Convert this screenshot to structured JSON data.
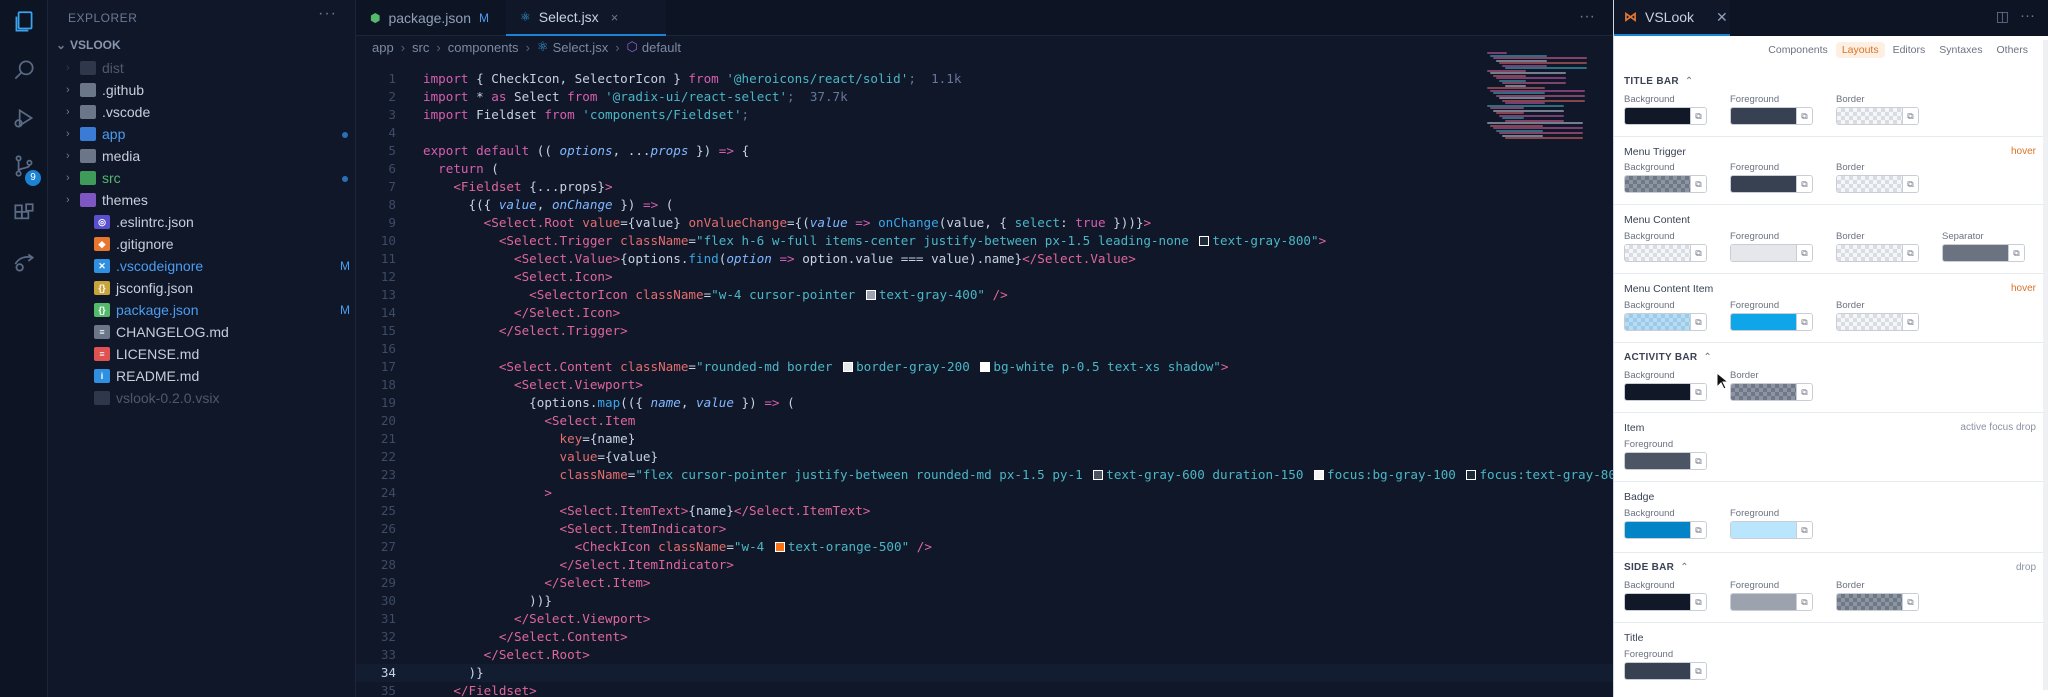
{
  "activity": {
    "scm_badge": "9"
  },
  "sidebar": {
    "title": "EXPLORER",
    "root": "VSLOOK",
    "items": [
      {
        "label": "dist",
        "type": "folder",
        "dim": true,
        "mark": ""
      },
      {
        "label": ".github",
        "type": "folder",
        "mark": ""
      },
      {
        "label": ".vscode",
        "type": "folder",
        "mark": ""
      },
      {
        "label": "app",
        "type": "folder",
        "style": "blue",
        "mark": "dot"
      },
      {
        "label": "media",
        "type": "folder",
        "mark": ""
      },
      {
        "label": "src",
        "type": "folder",
        "style": "green",
        "mark": "dot"
      },
      {
        "label": "themes",
        "type": "folder",
        "mark": ""
      },
      {
        "label": ".eslintrc.json",
        "type": "file",
        "mark": ""
      },
      {
        "label": ".gitignore",
        "type": "file",
        "mark": ""
      },
      {
        "label": ".vscodeignore",
        "type": "file",
        "style": "blue",
        "mark": "M"
      },
      {
        "label": "jsconfig.json",
        "type": "file",
        "mark": ""
      },
      {
        "label": "package.json",
        "type": "file",
        "style": "blue",
        "mark": "M"
      },
      {
        "label": "CHANGELOG.md",
        "type": "file",
        "mark": ""
      },
      {
        "label": "LICENSE.md",
        "type": "file",
        "mark": ""
      },
      {
        "label": "README.md",
        "type": "file",
        "mark": ""
      },
      {
        "label": "vslook-0.2.0.vsix",
        "type": "file",
        "dim": true,
        "mark": ""
      }
    ]
  },
  "tabs": [
    {
      "label": "package.json",
      "mod": "M"
    },
    {
      "label": "Select.jsx",
      "close": "×"
    }
  ],
  "breadcrumb": [
    "app",
    "src",
    "components",
    "Select.jsx",
    "default"
  ],
  "editor": {
    "current_line": "34",
    "line_numbers": [
      "1",
      "2",
      "3",
      "4",
      "5",
      "6",
      "7",
      "8",
      "9",
      "10",
      "11",
      "12",
      "13",
      "14",
      "15",
      "16",
      "17",
      "18",
      "19",
      "20",
      "21",
      "22",
      "23",
      "24",
      "25",
      "26",
      "27",
      "28",
      "29",
      "30",
      "31",
      "32",
      "33",
      "34",
      "35"
    ]
  },
  "panel": {
    "tab_label": "VSLook",
    "nav": [
      "Components",
      "Layouts",
      "Editors",
      "Syntaxes",
      "Others"
    ],
    "active_nav": "Layouts",
    "sections": {
      "title_bar": "TITLE BAR",
      "menu_trigger": "Menu Trigger",
      "menu_content": "Menu Content",
      "menu_content_item": "Menu Content Item",
      "activity_bar": "ACTIVITY BAR",
      "item": "Item",
      "badge": "Badge",
      "side_bar": "SIDE BAR",
      "title": "Title"
    },
    "labels": {
      "background": "Background",
      "foreground": "Foreground",
      "border": "Border",
      "separator": "Separator"
    },
    "notes": {
      "hover": "hover",
      "item_states": "active  focus  drop",
      "drop": "drop"
    },
    "colors": {
      "title_bar": [
        "#111827",
        "#374151",
        "checker"
      ],
      "menu_trigger": [
        "checker-dark",
        "#374151",
        "checker"
      ],
      "menu_content": [
        "checker",
        "#e5e7eb",
        "checker",
        "#6b7280"
      ],
      "menu_content_item": [
        "checker-blue",
        "#0ea5e9",
        "checker"
      ],
      "activity_bar": [
        "#111827",
        "checker-dark"
      ],
      "item": [
        "#4b5563"
      ],
      "badge": [
        "#0284c7",
        "#bae6fd"
      ],
      "side_bar": [
        "#111827",
        "#9ca3af",
        "checker-dark"
      ],
      "title": [
        "#374151"
      ]
    }
  }
}
